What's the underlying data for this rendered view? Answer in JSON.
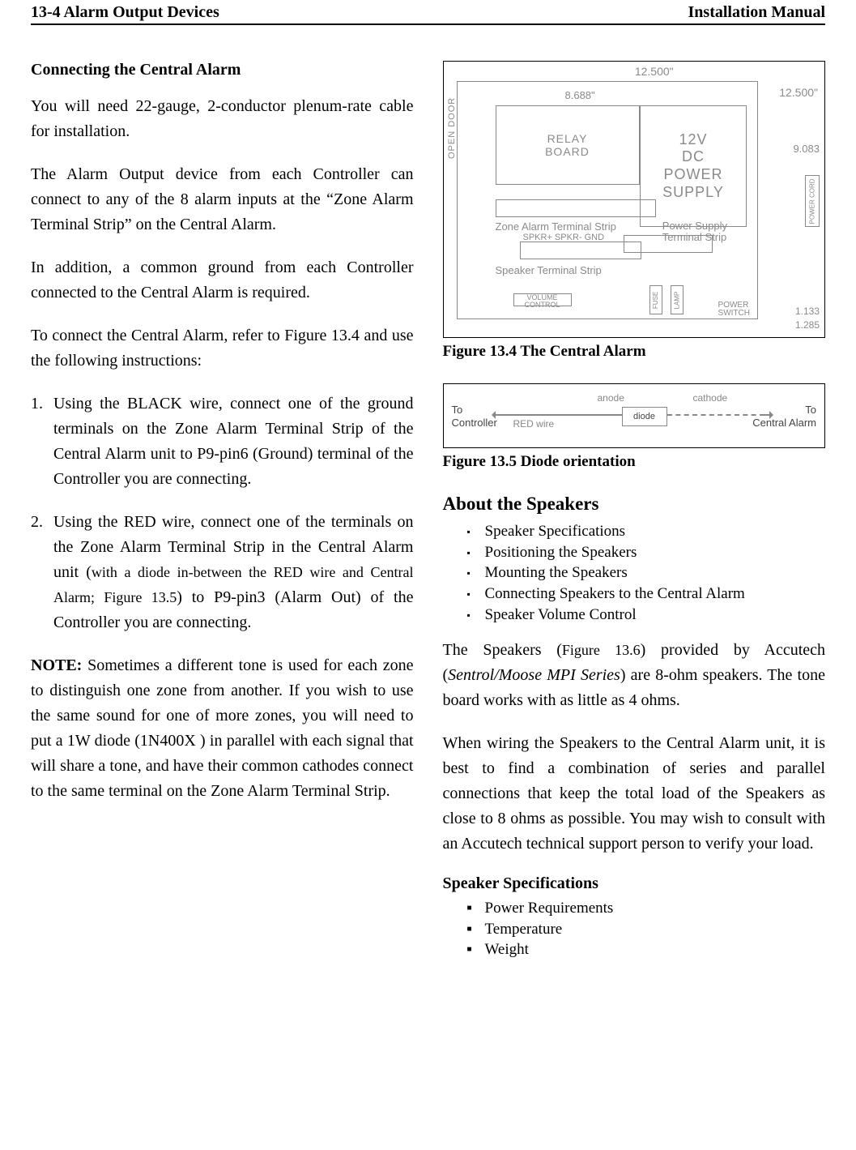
{
  "header": {
    "left": "13-4 Alarm Output Devices",
    "right": "Installation Manual"
  },
  "left": {
    "h3": "Connecting the Central Alarm",
    "p1": "You will need 22-gauge, 2-conductor plenum-rate cable for installation.",
    "p2": "The Alarm Output device from each Controller can connect to any of the 8 alarm inputs at the “Zone Alarm Terminal Strip” on the Central Alarm.",
    "p3": "In addition, a common ground from each Controller connected to the Central Alarm is required.",
    "p4": "To connect the Central Alarm, refer to Figure 13.4 and use the following instructions:",
    "li1_num": "1.",
    "li1": "Using the BLACK wire, connect one of the ground terminals on the Zone Alarm Terminal Strip of the Central Alarm unit to P9-pin6 (Ground) terminal of the Controller you are connecting.",
    "li2_num": "2.",
    "li2_a": "Using the RED wire, connect one of the terminals on the Zone Alarm Terminal Strip in the Central Alarm unit (",
    "li2_small": "with a diode in-between the RED wire and Central Alarm; Figure 13.5",
    "li2_b": ") to P9-pin3 (Alarm Out) of the Controller you are connecting.",
    "note_label": "NOTE:",
    "note": " Sometimes a different tone is used for each zone to distinguish one zone from another. If you wish to use the same sound for one of more zones, you will need to put a 1W diode (1N400X ) in parallel with each signal that will share a tone, and have their common cathodes connect to the same terminal on the Zone Alarm Terminal Strip."
  },
  "fig134": {
    "caption": "Figure 13.4 The Central Alarm",
    "dim_top": "12.500\"",
    "dim_right": "12.500\"",
    "dim8": "8.688\"",
    "dim9": "9.083",
    "opendoor": "OPEN DOOR",
    "relay1": "RELAY",
    "relay2": "BOARD",
    "psu1": "12V",
    "psu2": "DC",
    "psu3": "POWER",
    "psu4": "SUPPLY",
    "zstrip": "Zone Alarm Terminal Strip",
    "pstrip1": "Power Supply",
    "pstrip2": "Terminal Strip",
    "sstrip_t": "SPKR+ SPKR- GND",
    "sstrip": "Speaker Terminal Strip",
    "vol": "VOLUME CONTROL",
    "fuse": "FUSE",
    "lamp": "LAMP",
    "psw1": "POWER",
    "psw2": "SWITCH",
    "pcord": "POWER CORD",
    "n1": "1.133",
    "n2": "1.285"
  },
  "fig135": {
    "caption": "Figure 13.5 Diode orientation",
    "to_ctrl1": "To",
    "to_ctrl2": "Controller",
    "to_ca1": "To",
    "to_ca2": "Central Alarm",
    "red": "RED wire",
    "anode": "anode",
    "cathode": "cathode",
    "diode": "diode"
  },
  "speakers": {
    "h2": "About the Speakers",
    "items": {
      "a": "Speaker Specifications",
      "b": "Positioning the Speakers",
      "c": "Mounting the Speakers",
      "d": "Connecting Speakers to the Central Alarm",
      "e": "Speaker Volume Control"
    },
    "p1_a": "The Speakers (",
    "p1_sm": "Figure 13.6",
    "p1_b": ") provided by Accutech (",
    "p1_em": "Sentrol/Moose MPI Series",
    "p1_c": ") are 8-ohm speakers. The tone board works with as little as 4 ohms.",
    "p2": "When wiring the Speakers to the Central Alarm unit, it is best to find a combination of series and parallel connections that keep the total load of the Speakers as close to 8 ohms as possible. You may wish to consult with an Accutech technical support person to verify your load.",
    "spec_h": "Speaker Specifications",
    "spec": {
      "a": "Power Requirements",
      "b": "Temperature",
      "c": "Weight"
    }
  }
}
